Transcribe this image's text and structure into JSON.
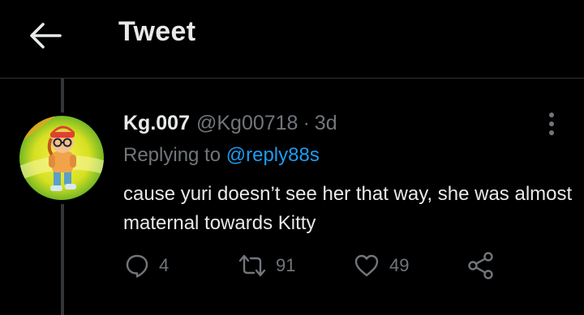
{
  "header": {
    "title": "Tweet",
    "back_icon": "arrow-left-icon"
  },
  "tweet": {
    "display_name": "Kg.007",
    "handle": "@Kg00718",
    "separator": "·",
    "time": "3d",
    "replying_prefix": "Replying to",
    "replying_handle": "@reply88s",
    "text": "cause yuri doesn’t see her that way, she was almost maternal towards Kitty",
    "more_icon": "more-vertical-icon",
    "avatar_icon": "avatar-character-icon"
  },
  "actions": {
    "reply_count": "4",
    "retweet_count": "91",
    "like_count": "49",
    "reply_icon": "reply-icon",
    "retweet_icon": "retweet-icon",
    "like_icon": "heart-icon",
    "share_icon": "share-icon"
  },
  "colors": {
    "background": "#000000",
    "text": "#e7e9ea",
    "muted": "#71767b",
    "link": "#1d9bf0",
    "divider": "#2f3336"
  }
}
